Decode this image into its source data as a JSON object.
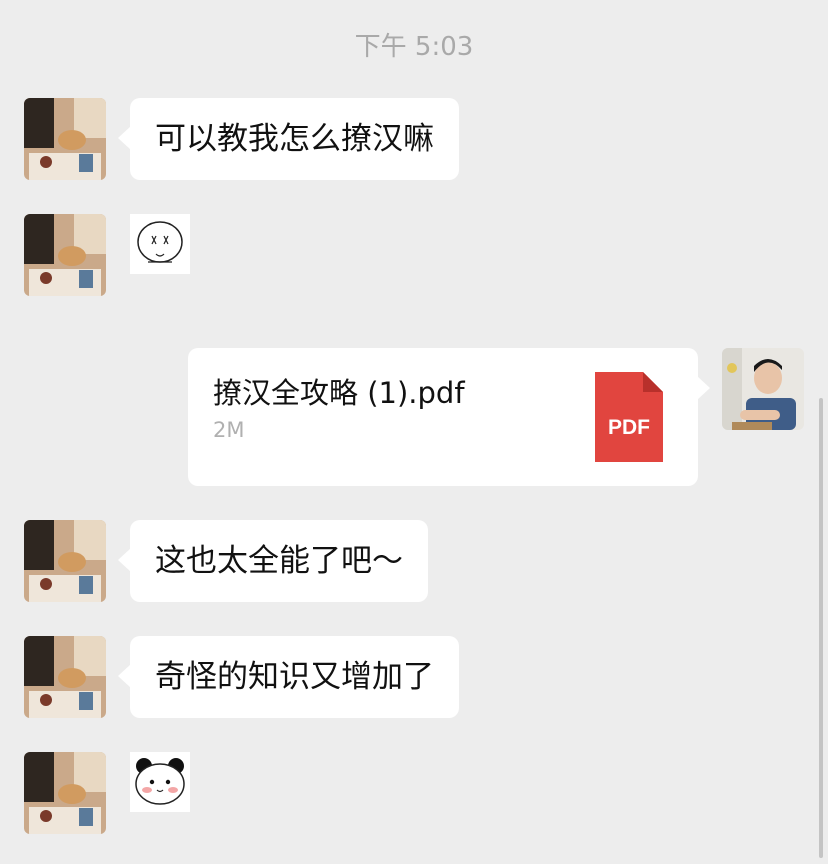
{
  "chat": {
    "timestamp": "下午 5:03",
    "messages": [
      {
        "side": "left",
        "type": "text",
        "text": "可以教我怎么撩汉嘛"
      },
      {
        "side": "left",
        "type": "sticker",
        "sticker": "blank-face-sticker"
      },
      {
        "side": "right",
        "type": "file",
        "file_name": "撩汉全攻略 (1).pdf",
        "file_size": "2M",
        "file_type_label": "PDF"
      },
      {
        "side": "left",
        "type": "text",
        "text": "这也太全能了吧～"
      },
      {
        "side": "left",
        "type": "text",
        "text": "奇怪的知识又增加了"
      },
      {
        "side": "left",
        "type": "sticker",
        "sticker": "panda-blush-sticker"
      }
    ]
  },
  "colors": {
    "background": "#ededed",
    "bubble": "#ffffff",
    "pdf_red": "#e1453f",
    "timestamp": "#a9a9a9"
  }
}
